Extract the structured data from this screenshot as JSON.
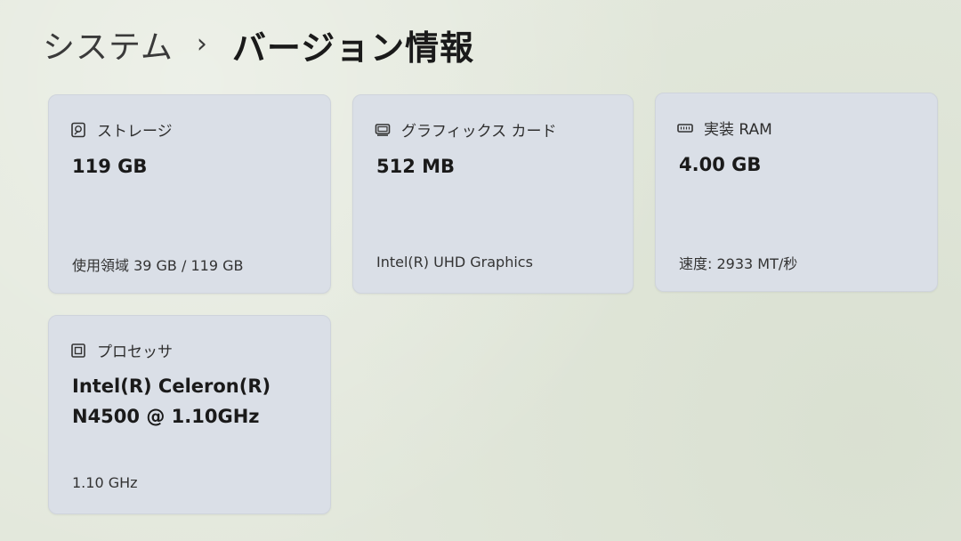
{
  "breadcrumb": {
    "parent": "システム",
    "separator": "›",
    "current": "バージョン情報"
  },
  "cards": {
    "storage": {
      "title": "ストレージ",
      "value": "119 GB",
      "detail": "使用領域 39 GB / 119 GB",
      "icon": "storage-icon"
    },
    "graphics": {
      "title": "グラフィックス カード",
      "value": "512 MB",
      "detail": "Intel(R) UHD Graphics",
      "icon": "graphics-card-icon"
    },
    "ram": {
      "title": "実装 RAM",
      "value": "4.00 GB",
      "detail": "速度: 2933 MT/秒",
      "icon": "memory-icon"
    },
    "processor": {
      "title": "プロセッサ",
      "value_line1": "Intel(R) Celeron(R)",
      "value_line2": "N4500 @ 1.10GHz",
      "detail": "1.10 GHz",
      "icon": "processor-icon"
    }
  }
}
